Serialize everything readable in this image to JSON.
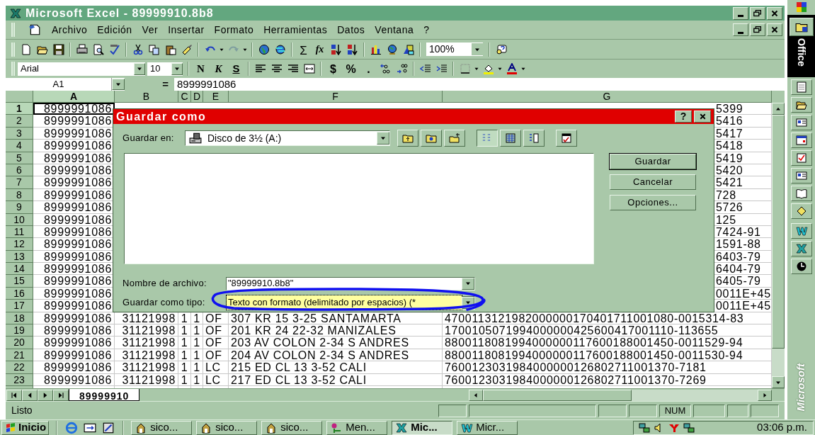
{
  "window": {
    "title": "Microsoft Excel - 89999910.8b8"
  },
  "menu": [
    "Archivo",
    "Edición",
    "Ver",
    "Insertar",
    "Formato",
    "Herramientas",
    "Datos",
    "Ventana",
    "?"
  ],
  "standard_toolbar": {
    "sum": "Σ",
    "function": "fx",
    "zoom": "100%"
  },
  "format_toolbar": {
    "font": "Arial",
    "size": "10",
    "style_buttons": [
      "N",
      "K",
      "S"
    ],
    "number_buttons": [
      "$",
      "%",
      "."
    ]
  },
  "formula_bar": {
    "cell": "A1",
    "equals": "=",
    "value": "8999991086"
  },
  "columns": [
    {
      "label": "A",
      "selected": true
    },
    {
      "label": "B",
      "selected": false
    },
    {
      "label": "C",
      "selected": false
    },
    {
      "label": "D",
      "selected": false
    },
    {
      "label": "E",
      "selected": false
    },
    {
      "label": "F",
      "selected": false
    },
    {
      "label": "G",
      "selected": false
    }
  ],
  "rows": [
    {
      "number": "1",
      "selected": true,
      "kind": "covered",
      "cells": [
        "8999991086"
      ],
      "tail": "5399"
    },
    {
      "number": "2",
      "selected": false,
      "kind": "covered",
      "cells": [
        "8999991086"
      ],
      "tail": "5416"
    },
    {
      "number": "3",
      "selected": false,
      "kind": "covered",
      "cells": [
        "8999991086"
      ],
      "tail": "5417"
    },
    {
      "number": "4",
      "selected": false,
      "kind": "covered",
      "cells": [
        "8999991086"
      ],
      "tail": "5418"
    },
    {
      "number": "5",
      "selected": false,
      "kind": "covered",
      "cells": [
        "8999991086"
      ],
      "tail": "5419"
    },
    {
      "number": "6",
      "selected": false,
      "kind": "covered",
      "cells": [
        "8999991086"
      ],
      "tail": "5420"
    },
    {
      "number": "7",
      "selected": false,
      "kind": "covered",
      "cells": [
        "8999991086"
      ],
      "tail": "5421"
    },
    {
      "number": "8",
      "selected": false,
      "kind": "covered",
      "cells": [
        "8999991086"
      ],
      "tail": "728"
    },
    {
      "number": "9",
      "selected": false,
      "kind": "covered",
      "cells": [
        "8999991086"
      ],
      "tail": "5726"
    },
    {
      "number": "10",
      "selected": false,
      "kind": "covered",
      "cells": [
        "8999991086"
      ],
      "tail": "125"
    },
    {
      "number": "11",
      "selected": false,
      "kind": "covered",
      "cells": [
        "8999991086"
      ],
      "tail": "7424-91"
    },
    {
      "number": "12",
      "selected": false,
      "kind": "covered",
      "cells": [
        "8999991086"
      ],
      "tail": "1591-88"
    },
    {
      "number": "13",
      "selected": false,
      "kind": "covered",
      "cells": [
        "8999991086"
      ],
      "tail": "6403-79"
    },
    {
      "number": "14",
      "selected": false,
      "kind": "covered",
      "cells": [
        "8999991086"
      ],
      "tail": "6404-79"
    },
    {
      "number": "15",
      "selected": false,
      "kind": "covered",
      "cells": [
        "8999991086"
      ],
      "tail": "6405-79"
    },
    {
      "number": "16",
      "selected": false,
      "kind": "covered",
      "cells": [
        "8999991086"
      ],
      "tail": "0011E+45"
    },
    {
      "number": "17",
      "selected": false,
      "kind": "covered",
      "cells": [
        "8999991086"
      ],
      "tail": "0011E+45"
    },
    {
      "number": "18",
      "selected": false,
      "kind": "full",
      "cells": [
        "8999991086",
        "31121998",
        "1",
        "1",
        "OF",
        "307 KR 15 3-25  SANTAMARTA",
        "4700113121982000000170401711001080-0015314-83"
      ]
    },
    {
      "number": "19",
      "selected": false,
      "kind": "full",
      "cells": [
        "8999991086",
        "31121998",
        "1",
        "1",
        "OF",
        "201 KR 24 22-32 MANIZALES",
        "1700105071994000000425600417001110-113655"
      ]
    },
    {
      "number": "20",
      "selected": false,
      "kind": "full",
      "cells": [
        "8999991086",
        "31121998",
        "1",
        "1",
        "OF",
        "203 AV COLON 2-34 S ANDRES",
        "8800118081994000000117600188001450-0011529-94"
      ]
    },
    {
      "number": "21",
      "selected": false,
      "kind": "full",
      "cells": [
        "8999991086",
        "31121998",
        "1",
        "1",
        "OF",
        "204 AV COLON 2-34 S ANDRES",
        "8800118081994000000117600188001450-0011530-94"
      ]
    },
    {
      "number": "22",
      "selected": false,
      "kind": "full",
      "cells": [
        "8999991086",
        "31121998",
        "1",
        "1",
        "LC",
        "215 ED CL 13 3-52 CALI",
        "7600123031984000000126802711001370-7181"
      ]
    },
    {
      "number": "23",
      "selected": false,
      "kind": "full",
      "cells": [
        "8999991086",
        "31121998",
        "1",
        "1",
        "LC",
        "217 ED CL 13 3-52 CALI",
        "7600123031984000000126802711001370-7269"
      ]
    }
  ],
  "dialog": {
    "title": "Guardar como",
    "help": "?",
    "save_in_label": "Guardar en:",
    "save_in": "Disco de 3½ (A:)",
    "buttons": [
      "Guardar",
      "Cancelar",
      "Opciones..."
    ],
    "file_name_label": "Nombre de archivo:",
    "file_name": "\"89999910.8b8\"",
    "type_label": "Guardar como tipo:",
    "type": "Texto con formato (delimitado por espacios) (*",
    "type_selected": true
  },
  "sheet_tabs": [
    {
      "label": "89999910",
      "selected": true
    }
  ],
  "status_bar": {
    "text": "Listo",
    "indicators": [
      "NUM"
    ]
  },
  "taskbar": {
    "start": "Inicio",
    "tasks": [
      {
        "label": "sico...",
        "kind": "app",
        "selected": false
      },
      {
        "label": "sico...",
        "kind": "app",
        "selected": false
      },
      {
        "label": "sico...",
        "kind": "app",
        "selected": false
      },
      {
        "label": "Men...",
        "kind": "menu",
        "selected": false
      },
      {
        "label": "Mic...",
        "kind": "excel",
        "selected": true
      },
      {
        "label": "Micr...",
        "kind": "word",
        "selected": false
      }
    ],
    "clock": "03:06 p.m."
  },
  "office_bar": {
    "title": "Office",
    "footer": "Microsoft"
  }
}
